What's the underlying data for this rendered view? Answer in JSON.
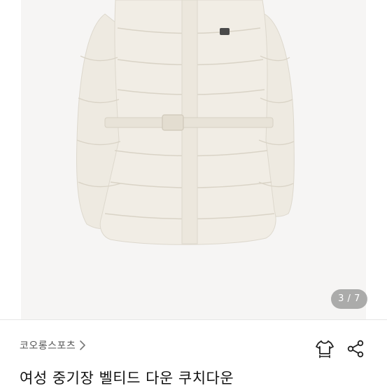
{
  "gallery": {
    "image_alt": "product-photo-down-jacket",
    "counter": "3 / 7"
  },
  "product": {
    "brand": "코오롱스포츠",
    "title": "여성 중기장 벨티드 다운 쿠치다운"
  },
  "icons": {
    "brand_chevron": "chevron-right-icon",
    "size_guide": "shirt-size-icon",
    "share": "share-icon"
  },
  "colors": {
    "jacket": "#efebe2",
    "background": "#f6f5f4",
    "text_primary": "#111111",
    "text_secondary": "#555555"
  }
}
